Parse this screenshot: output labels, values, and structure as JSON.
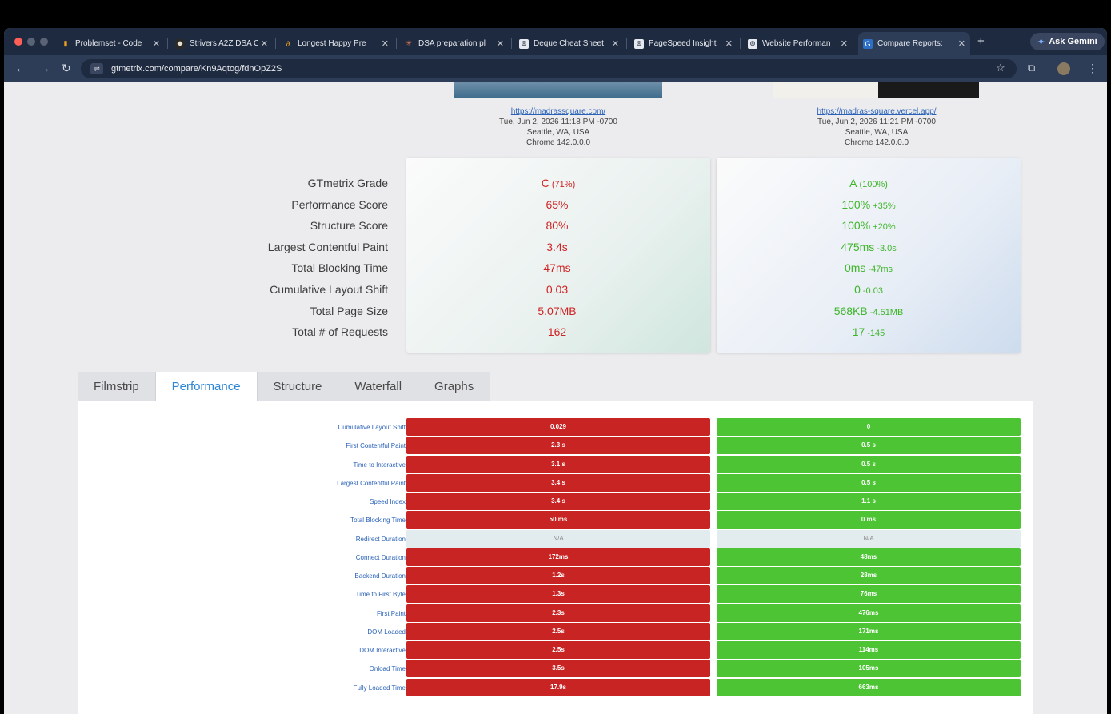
{
  "browser": {
    "tabs": [
      {
        "title": "Problemset - Code",
        "icon": "chart-icon"
      },
      {
        "title": "Strivers A2Z DSA C",
        "icon": "striver-icon"
      },
      {
        "title": "Longest Happy Pre",
        "icon": "leetcode-icon"
      },
      {
        "title": "DSA preparation pl",
        "icon": "claude-icon"
      },
      {
        "title": "Deque Cheat Sheet",
        "icon": "chatgpt-icon"
      },
      {
        "title": "PageSpeed Insight",
        "icon": "chatgpt-icon"
      },
      {
        "title": "Website Performan",
        "icon": "chatgpt-icon"
      },
      {
        "title": "Compare Reports:",
        "icon": "gtmetrix-icon"
      }
    ],
    "active_tab": 7,
    "new_tab_label": "+",
    "gemini_label": "Ask Gemini",
    "url": "gtmetrix.com/compare/Kn9Aqtog/fdnOpZ2S"
  },
  "reports": [
    {
      "url": "https://madrassquare.com/",
      "date": "Tue, Jun 2, 2026 11:18 PM -0700",
      "location": "Seattle, WA, USA",
      "browser": "Chrome 142.0.0.0"
    },
    {
      "url": "https://madras-square.vercel.app/",
      "date": "Tue, Jun 2, 2026 11:21 PM -0700",
      "location": "Seattle, WA, USA",
      "browser": "Chrome 142.0.0.0"
    }
  ],
  "summary": {
    "labels": [
      "GTmetrix Grade",
      "Performance Score",
      "Structure Score",
      "Largest Contentful Paint",
      "Total Blocking Time",
      "Cumulative Layout Shift",
      "Total Page Size",
      "Total # of Requests"
    ],
    "a": [
      {
        "v": "C",
        "d": "(71%)"
      },
      {
        "v": "65%",
        "d": ""
      },
      {
        "v": "80%",
        "d": ""
      },
      {
        "v": "3.4s",
        "d": ""
      },
      {
        "v": "47ms",
        "d": ""
      },
      {
        "v": "0.03",
        "d": ""
      },
      {
        "v": "5.07MB",
        "d": ""
      },
      {
        "v": "162",
        "d": ""
      }
    ],
    "b": [
      {
        "v": "A",
        "d": "(100%)"
      },
      {
        "v": "100%",
        "d": "+35%"
      },
      {
        "v": "100%",
        "d": "+20%"
      },
      {
        "v": "475ms",
        "d": "-3.0s"
      },
      {
        "v": "0ms",
        "d": "-47ms"
      },
      {
        "v": "0",
        "d": "-0.03"
      },
      {
        "v": "568KB",
        "d": "-4.51MB"
      },
      {
        "v": "17",
        "d": "-145"
      }
    ]
  },
  "report_tabs": [
    "Filmstrip",
    "Performance",
    "Structure",
    "Waterfall",
    "Graphs"
  ],
  "active_report_tab": 1,
  "metrics": [
    {
      "label": "Cumulative Layout Shift",
      "a": "0.029",
      "b": "0"
    },
    {
      "label": "First Contentful Paint",
      "a": "2.3 s",
      "b": "0.5 s"
    },
    {
      "label": "Time to Interactive",
      "a": "3.1 s",
      "b": "0.5 s"
    },
    {
      "label": "Largest Contentful Paint",
      "a": "3.4 s",
      "b": "0.5 s"
    },
    {
      "label": "Speed Index",
      "a": "3.4 s",
      "b": "1.1 s"
    },
    {
      "label": "Total Blocking Time",
      "a": "50 ms",
      "b": "0 ms"
    },
    {
      "label": "Redirect Duration",
      "a": "N/A",
      "b": "N/A",
      "na": true
    },
    {
      "label": "Connect Duration",
      "a": "172ms",
      "b": "48ms"
    },
    {
      "label": "Backend Duration",
      "a": "1.2s",
      "b": "28ms"
    },
    {
      "label": "Time to First Byte",
      "a": "1.3s",
      "b": "76ms"
    },
    {
      "label": "First Paint",
      "a": "2.3s",
      "b": "476ms"
    },
    {
      "label": "DOM Loaded",
      "a": "2.5s",
      "b": "171ms"
    },
    {
      "label": "DOM Interactive",
      "a": "2.5s",
      "b": "114ms"
    },
    {
      "label": "Onload Time",
      "a": "3.5s",
      "b": "105ms"
    },
    {
      "label": "Fully Loaded Time",
      "a": "17.9s",
      "b": "663ms"
    }
  ],
  "colors": {
    "worse": "#c82424",
    "better": "#4cc433",
    "accent": "#2d86d6"
  }
}
